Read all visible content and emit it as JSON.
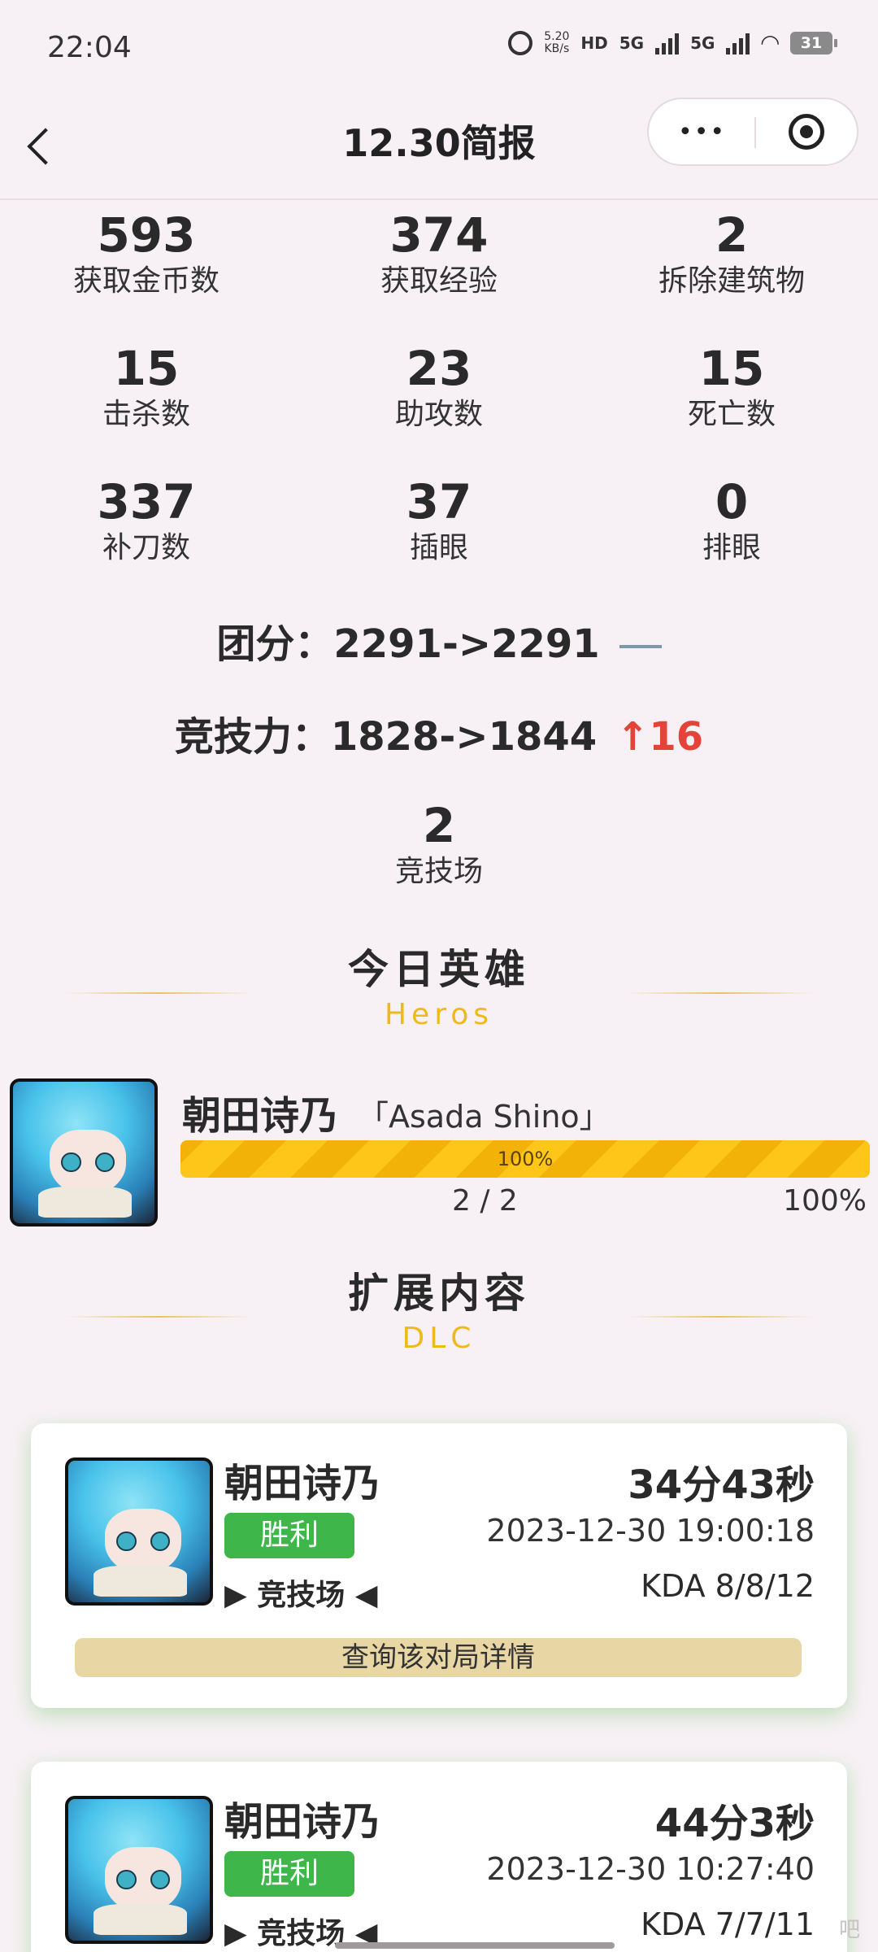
{
  "status_bar": {
    "time": "22:04",
    "speed_value": "5.20",
    "speed_unit": "KB/s",
    "hd_label": "HD",
    "net1": "5G",
    "net2": "5G",
    "battery": "31"
  },
  "header": {
    "title": "12.30简报"
  },
  "stats": [
    [
      {
        "value": "593",
        "label": "获取金币数"
      },
      {
        "value": "374",
        "label": "获取经验"
      },
      {
        "value": "2",
        "label": "拆除建筑物"
      }
    ],
    [
      {
        "value": "15",
        "label": "击杀数"
      },
      {
        "value": "23",
        "label": "助攻数"
      },
      {
        "value": "15",
        "label": "死亡数"
      }
    ],
    [
      {
        "value": "337",
        "label": "补刀数"
      },
      {
        "value": "37",
        "label": "插眼"
      },
      {
        "value": "0",
        "label": "排眼"
      }
    ]
  ],
  "team_score": {
    "label": "团分：",
    "value": "2291->2291"
  },
  "power": {
    "label": "竞技力：",
    "value": "1828->1844",
    "change": "↑16",
    "change_color": "#e54339"
  },
  "arena": {
    "value": "2",
    "label": "竞技场"
  },
  "heroes_section": {
    "title": "今日英雄",
    "subtitle": "Heros"
  },
  "hero": {
    "name": "朝田诗乃",
    "english": "「Asada Shino」",
    "progress_fraction": 1.0,
    "progress_label": "100%",
    "count": "2 / 2",
    "percent": "100%"
  },
  "dlc_section": {
    "title": "扩展内容",
    "subtitle": "DLC"
  },
  "matches": [
    {
      "hero": "朝田诗乃",
      "result": "胜利",
      "mode": "▶ 竞技场 ◀",
      "duration": "34分43秒",
      "datetime": "2023-12-30 19:00:18",
      "kda": "KDA 8/8/12",
      "detail_button": "查询该对局详情"
    },
    {
      "hero": "朝田诗乃",
      "result": "胜利",
      "mode": "▶ 竞技场 ◀",
      "duration": "44分3秒",
      "datetime": "2023-12-30 10:27:40",
      "kda": "KDA 7/7/11"
    }
  ],
  "watermark": "吧",
  "colors": {
    "background": "#f7f1f5",
    "win_green": "#3fb649",
    "accent_gold": "#f0b91a",
    "progress_yellow": "#ffc61a",
    "detail_button_bg": "#e8d6a4"
  }
}
